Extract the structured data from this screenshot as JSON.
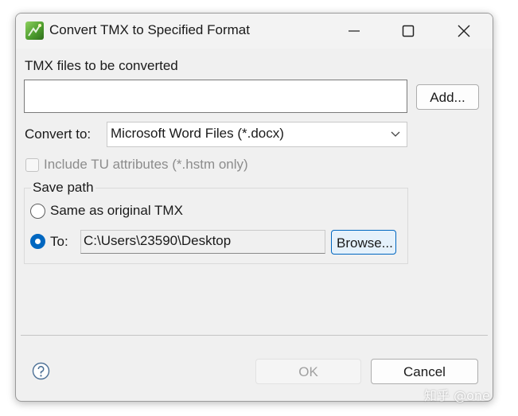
{
  "window": {
    "title": "Convert TMX to Specified Format",
    "app_icon": "tmx-converter-icon",
    "controls": {
      "minimize": "minimize-icon",
      "maximize": "maximize-icon",
      "close": "close-icon"
    }
  },
  "files": {
    "label": "TMX files to be converted",
    "value": "",
    "add_label": "Add..."
  },
  "convert": {
    "label": "Convert to:",
    "selected": "Microsoft Word Files (*.docx)"
  },
  "include_tu": {
    "label": "Include TU attributes (*.hstm only)",
    "checked": false,
    "enabled": false
  },
  "save_path": {
    "legend": "Save path",
    "same_label": "Same as original TMX",
    "to_label": "To:",
    "selected_option": "to",
    "path": "C:\\Users\\23590\\Desktop",
    "browse_label": "Browse..."
  },
  "footer": {
    "help_icon": "help-icon",
    "ok_label": "OK",
    "ok_enabled": false,
    "cancel_label": "Cancel"
  },
  "watermark": "知乎 @one",
  "colors": {
    "accent": "#0067c0",
    "dialog_bg": "#f0f0f0",
    "disabled_text": "#8c8c8c"
  }
}
